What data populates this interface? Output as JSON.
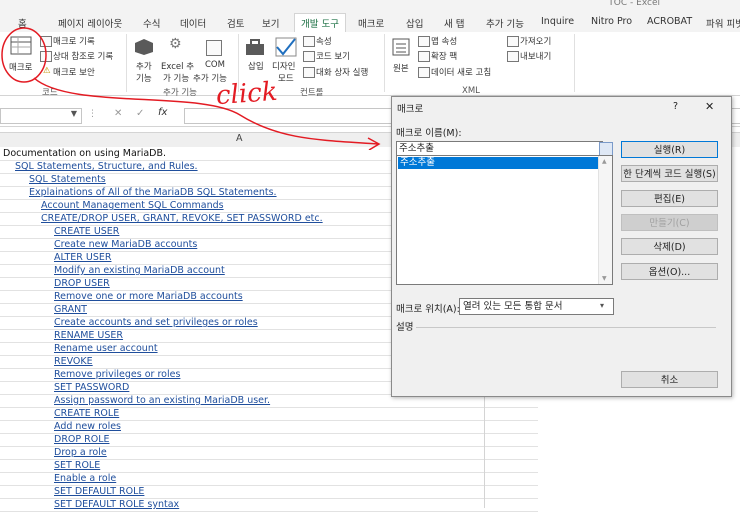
{
  "window": {
    "title": "TOC - Excel"
  },
  "ribbon_tabs": [
    "홈",
    "페이지 레이아웃",
    "수식",
    "데이터",
    "검토",
    "보기",
    "개발 도구",
    "매크로",
    "삽입",
    "새 탭",
    "추가 기능",
    "Inquire",
    "Nitro Pro",
    "ACROBAT",
    "파워 피벗"
  ],
  "active_tab": "개발 도구",
  "ribbon": {
    "code": {
      "group_label": "코드",
      "macro_button": "매크로",
      "record": "매크로 기록",
      "relative": "상대 참조로 기록",
      "security": "매크로 보안"
    },
    "addins": {
      "group_label": "추가 기능",
      "addin": [
        "추가",
        "기능"
      ],
      "excel_addin": [
        "Excel 추",
        "가 기능"
      ],
      "com_addin": [
        "COM",
        "추가 기능"
      ]
    },
    "controls": {
      "group_label": "컨트롤",
      "insert": "삽입",
      "design_mode": [
        "디자인",
        "모드"
      ],
      "properties": "속성",
      "view_code": "코드 보기",
      "run_dialog": "대화 상자 실행"
    },
    "xml": {
      "group_label": "XML",
      "source": "원본",
      "map_properties": "맵 속성",
      "expansion_packs": "확장 팩",
      "refresh_data": "데이터 새로 고침",
      "import": "가져오기",
      "export": "내보내기"
    }
  },
  "annotation": {
    "text": "click",
    "color": "#e31b23"
  },
  "formula_bar": {
    "fx": "fx",
    "cancel": "✕",
    "enter": "✓"
  },
  "column_header": "A",
  "sheet_rows": [
    {
      "text": "Documentation on using MariaDB.",
      "level": 1
    },
    {
      "text": "SQL Statements, Structure, and Rules.",
      "level": 2
    },
    {
      "text": "SQL Statements",
      "level": 3
    },
    {
      "text": "Explainations of All of the MariaDB SQL Statements.",
      "level": 3
    },
    {
      "text": "Account Management SQL Commands",
      "level": 4
    },
    {
      "text": "CREATE/DROP USER, GRANT, REVOKE, SET PASSWORD etc.",
      "level": 4
    },
    {
      "text": "CREATE USER",
      "level": 5
    },
    {
      "text": "Create new MariaDB accounts",
      "level": 5
    },
    {
      "text": "ALTER USER",
      "level": 5
    },
    {
      "text": "Modify an existing MariaDB account",
      "level": 5
    },
    {
      "text": "DROP USER",
      "level": 5
    },
    {
      "text": "Remove one or more MariaDB accounts",
      "level": 5
    },
    {
      "text": "GRANT",
      "level": 5
    },
    {
      "text": "Create accounts and set privileges or roles",
      "level": 5
    },
    {
      "text": "RENAME USER",
      "level": 5
    },
    {
      "text": "Rename user account",
      "level": 5
    },
    {
      "text": "REVOKE",
      "level": 5
    },
    {
      "text": "Remove privileges or roles",
      "level": 5
    },
    {
      "text": "SET PASSWORD",
      "level": 5
    },
    {
      "text": "Assign password to an existing MariaDB user.",
      "level": 5
    },
    {
      "text": "CREATE ROLE",
      "level": 5
    },
    {
      "text": "Add new roles",
      "level": 5
    },
    {
      "text": "DROP ROLE",
      "level": 5
    },
    {
      "text": "Drop a role",
      "level": 5
    },
    {
      "text": "SET ROLE",
      "level": 5
    },
    {
      "text": "Enable a role",
      "level": 5
    },
    {
      "text": "SET DEFAULT ROLE",
      "level": 5
    },
    {
      "text": "SET DEFAULT ROLE syntax",
      "level": 5
    }
  ],
  "dialog": {
    "title": "매크로",
    "help": "?",
    "close": "✕",
    "name_label": "매크로 이름(M):",
    "name_value": "주소추출",
    "macros": [
      "주소추출"
    ],
    "buttons": {
      "run": "실행(R)",
      "step": "한 단계씩 코드 실행(S)",
      "edit": "편집(E)",
      "create": "만들기(C)",
      "delete": "삭제(D)",
      "options": "옵션(O)...",
      "cancel": "취소"
    },
    "location_label": "매크로 위치(A):",
    "location_value": "열려 있는 모든 통합 문서",
    "description_label": "설명"
  }
}
